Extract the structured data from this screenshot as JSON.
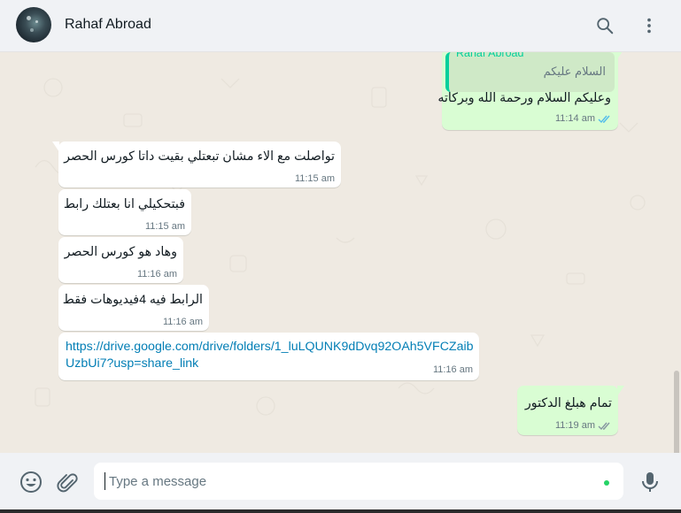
{
  "header": {
    "contact_name": "Rahaf Abroad",
    "search_icon": "search-icon",
    "menu_icon": "kebab-menu-icon"
  },
  "messages": [
    {
      "direction": "outgoing",
      "quoted": {
        "author": "Rahaf Abroad",
        "text": "السلام عليكم"
      },
      "text": "وعليكم السلام ورحمة الله وبركاته",
      "time": "11:14 am",
      "status": "read"
    },
    {
      "direction": "incoming",
      "text": "تواصلت مع الاء مشان تبعتلي بقيت داتا كورس الحصر",
      "time": "11:15 am"
    },
    {
      "direction": "incoming",
      "text": "فبتحكيلي انا بعتلك رابط",
      "time": "11:15 am"
    },
    {
      "direction": "incoming",
      "text": "وهاد هو كورس الحصر",
      "time": "11:16 am"
    },
    {
      "direction": "incoming",
      "text": "الرابط فيه 4فيديوهات فقط",
      "time": "11:16 am"
    },
    {
      "direction": "incoming",
      "link_line1": "https://drive.google.com/drive/folders/1_luLQUNK9dDvq92OAh5VFCZaib",
      "link_line2": "UzbUi7?usp=share_link",
      "time": "11:16 am"
    },
    {
      "direction": "outgoing",
      "text": "تمام هبلغ الدكتور",
      "time": "11:19 am",
      "status": "delivered"
    }
  ],
  "composer": {
    "placeholder": "Type a message",
    "emoji_icon": "emoji-icon",
    "attach_icon": "paperclip-icon",
    "mic_icon": "microphone-icon"
  },
  "colors": {
    "chat_bg": "#efeae2",
    "outgoing_bubble": "#d9fdd3",
    "incoming_bubble": "#ffffff",
    "link": "#027eb5",
    "read_ticks": "#53bdeb",
    "accent": "#06cf9c"
  }
}
